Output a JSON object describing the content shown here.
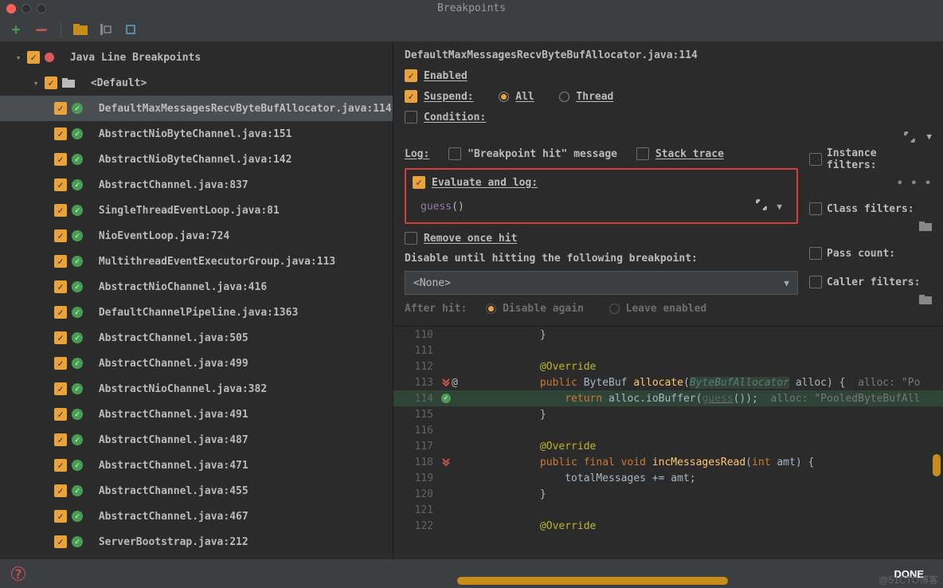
{
  "title": "Breakpoints",
  "toolbar": {
    "add": "+",
    "remove": "–"
  },
  "tree": {
    "root": "Java Line Breakpoints",
    "default_group": "<Default>",
    "items": [
      {
        "label": "DefaultMaxMessagesRecvByteBufAllocator.java:114",
        "selected": true
      },
      {
        "label": "AbstractNioByteChannel.java:151"
      },
      {
        "label": "AbstractNioByteChannel.java:142"
      },
      {
        "label": "AbstractChannel.java:837"
      },
      {
        "label": "SingleThreadEventLoop.java:81"
      },
      {
        "label": "NioEventLoop.java:724"
      },
      {
        "label": "MultithreadEventExecutorGroup.java:113"
      },
      {
        "label": "AbstractNioChannel.java:416"
      },
      {
        "label": "DefaultChannelPipeline.java:1363"
      },
      {
        "label": "AbstractChannel.java:505"
      },
      {
        "label": "AbstractChannel.java:499"
      },
      {
        "label": "AbstractNioChannel.java:382"
      },
      {
        "label": "AbstractChannel.java:491"
      },
      {
        "label": "AbstractChannel.java:487"
      },
      {
        "label": "AbstractChannel.java:471"
      },
      {
        "label": "AbstractChannel.java:455"
      },
      {
        "label": "AbstractChannel.java:467"
      },
      {
        "label": "ServerBootstrap.java:212"
      }
    ]
  },
  "right": {
    "header": "DefaultMaxMessagesRecvByteBufAllocator.java:114",
    "enabled": "Enabled",
    "suspend": "Suspend:",
    "suspend_opts": {
      "all": "All",
      "thread": "Thread"
    },
    "condition": "Condition:",
    "log": "Log:",
    "log_msg": "\"Breakpoint hit\" message",
    "log_stack": "Stack trace",
    "eval": "Evaluate and log:",
    "eval_expr_fn": "guess",
    "eval_expr_paren": "()",
    "remove": "Remove once hit",
    "disable_until": "Disable until hitting the following breakpoint:",
    "select_none": "<None>",
    "after_hit": "After hit:",
    "after_opts": {
      "disable": "Disable again",
      "leave": "Leave enabled"
    },
    "filters": {
      "instance": "Instance filters:",
      "class": "Class filters:",
      "pass": "Pass count:",
      "caller": "Caller filters:"
    }
  },
  "code": {
    "lines": [
      {
        "n": "110",
        "t": "            }"
      },
      {
        "n": "111",
        "t": ""
      },
      {
        "n": "112",
        "t": "            @Override",
        "ann": true
      },
      {
        "n": "113",
        "ic": "impl",
        "at": "@",
        "t": "            public ByteBuf allocate(ByteBufAllocator alloc) {  alloc: \"Po"
      },
      {
        "n": "114",
        "ic": "tick",
        "hl": true,
        "t": "                return alloc.ioBuffer(guess());  alloc: \"PooledByteBufAll"
      },
      {
        "n": "115",
        "t": "            }"
      },
      {
        "n": "116",
        "t": ""
      },
      {
        "n": "117",
        "t": "            @Override",
        "ann": true
      },
      {
        "n": "118",
        "ic": "impl",
        "t": "            public final void incMessagesRead(int amt) {"
      },
      {
        "n": "119",
        "t": "                totalMessages += amt;"
      },
      {
        "n": "120",
        "t": "            }"
      },
      {
        "n": "121",
        "t": ""
      },
      {
        "n": "122",
        "t": "            @Override",
        "ann": true,
        "cut": true
      }
    ]
  },
  "footer": {
    "done": "DONE"
  },
  "watermark": "@51CTO博客"
}
